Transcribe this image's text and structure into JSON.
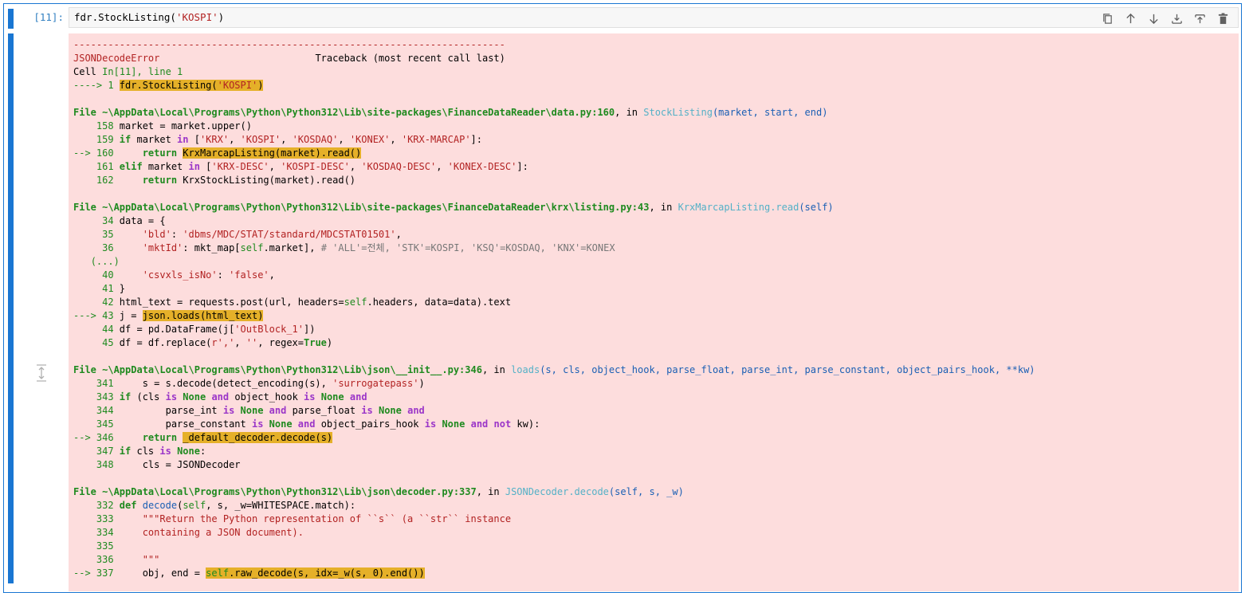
{
  "cell": {
    "prompt": "[11]:",
    "input_code_prefix": "fdr.StockListing(",
    "input_code_string": "'KOSPI'",
    "input_code_suffix": ")"
  },
  "toolbar": {
    "buttons": [
      "duplicate-icon",
      "move-up-icon",
      "move-down-icon",
      "insert-above-icon",
      "insert-below-icon",
      "delete-icon"
    ]
  },
  "colors": {
    "accent": "#1976d2",
    "error_bg": "#fddddd",
    "highlight": "#e5b029"
  },
  "traceback": {
    "dashes": "---------------------------------------------------------------------------",
    "error_name": "JSONDecodeError",
    "traceback_header": "Traceback (most recent call last)",
    "cell_loc_prefix": "Cell ",
    "cell_loc": "In[11], line 1",
    "arrow1": "----> 1 ",
    "line1_a": "fdr.StockListing(",
    "line1_s": "'KOSPI'",
    "line1_b": ")",
    "frame1_file": "File ~\\AppData\\Local\\Programs\\Python\\Python312\\Lib\\site-packages\\FinanceDataReader\\data.py:160",
    "frame1_in": ", in ",
    "frame1_func": "StockListing",
    "frame1_args": "(market, start, end)",
    "frame2_file": "File ~\\AppData\\Local\\Programs\\Python\\Python312\\Lib\\site-packages\\FinanceDataReader\\krx\\listing.py:43",
    "frame2_func": "KrxMarcapListing.read",
    "frame2_args": "(self)",
    "frame3_file": "File ~\\AppData\\Local\\Programs\\Python\\Python312\\Lib\\json\\__init__.py:346",
    "frame3_func": "loads",
    "frame3_args": "(s, cls, object_hook, parse_float, parse_int, parse_constant, object_pairs_hook, **kw)",
    "frame4_file": "File ~\\AppData\\Local\\Programs\\Python\\Python312\\Lib\\json\\decoder.py:337",
    "frame4_func": "JSONDecoder.decode",
    "frame4_args": "(self, s, _w)",
    "ellipsis": "(...)"
  }
}
